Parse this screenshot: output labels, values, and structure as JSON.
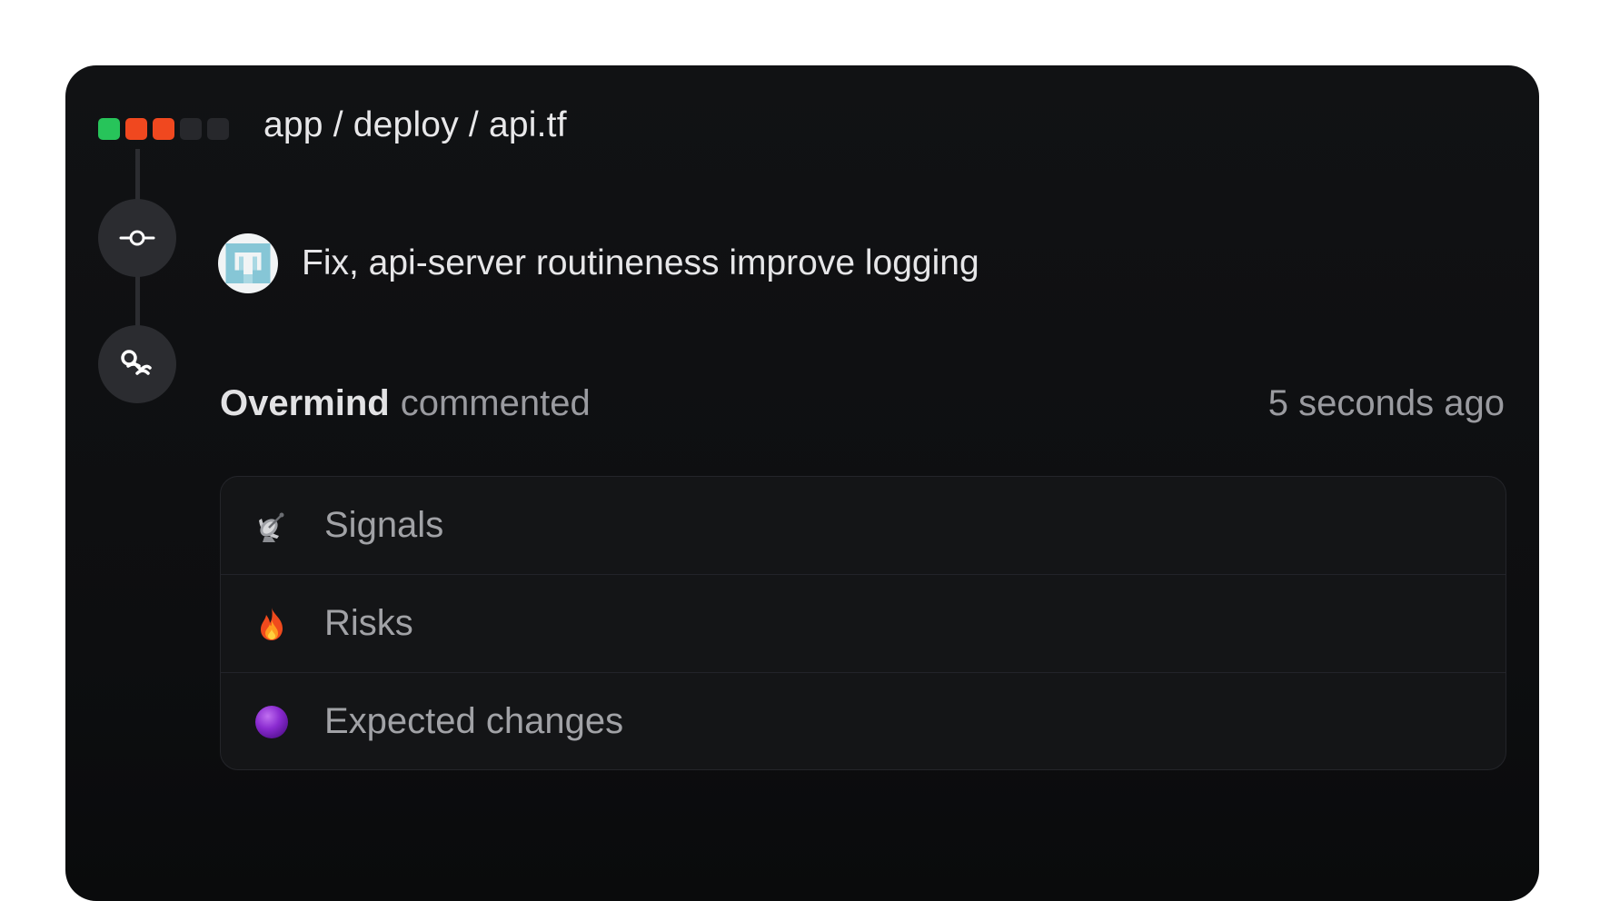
{
  "window": {
    "status_colors": [
      "#27c45a",
      "#f0481f",
      "#f0481f",
      "#27282c",
      "#27282c"
    ],
    "breadcrumb": "app / deploy / api.tf"
  },
  "commit": {
    "icon": "git-commit-icon",
    "avatar": "pixel-avatar",
    "message": "Fix, api-server routineness improve logging"
  },
  "comment": {
    "icon": "overmind-logo-icon",
    "author": "Overmind",
    "verb": "commented",
    "time": "5 seconds ago",
    "sections": [
      {
        "icon": "satellite-dish-icon",
        "label": "Signals"
      },
      {
        "icon": "fire-icon",
        "label": "Risks"
      },
      {
        "icon": "purple-circle-icon",
        "label": "Expected changes"
      }
    ]
  }
}
